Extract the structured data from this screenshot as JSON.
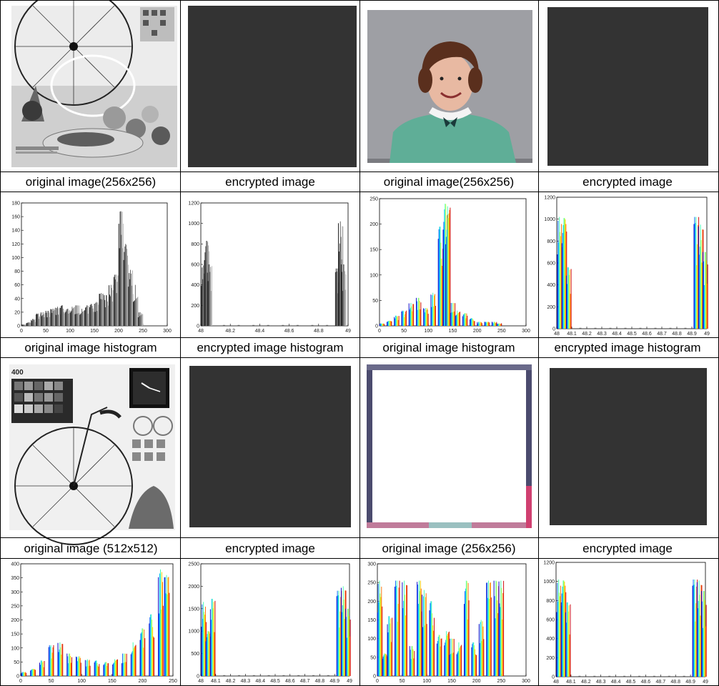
{
  "captions": {
    "row1": [
      "original image(256x256)",
      "encrypted image",
      "original image(256x256)",
      "encrypted image"
    ],
    "row2": [
      "original image histogram",
      "encrypted image histogram",
      "original image histogram",
      "encrypted image histogram"
    ],
    "row3": [
      "original image (512x512)",
      "encrypted image",
      "original image (256x256)",
      "encrypted image"
    ]
  },
  "image_labels": {
    "clock_image_label": "400"
  },
  "colors": {
    "encrypted_fill": "#333333",
    "grid_line": "#000000",
    "portrait_bg": "#9e9fa4",
    "sweater": "#5fae97"
  },
  "chart_data": [
    {
      "type": "bar",
      "panel": "histogram-gray-original",
      "color_scheme": "grayscale",
      "xlim": [
        0,
        300
      ],
      "ylim": [
        0,
        180
      ],
      "xticks": [
        "0",
        "50",
        "100",
        "150",
        "200",
        "250",
        "300"
      ],
      "yticks": [
        "0",
        "20",
        "40",
        "60",
        "80",
        "100",
        "120",
        "140",
        "160",
        "180"
      ],
      "x": [
        5,
        15,
        25,
        35,
        45,
        55,
        65,
        75,
        85,
        95,
        105,
        115,
        125,
        135,
        145,
        155,
        165,
        175,
        185,
        195,
        205,
        215,
        225,
        235,
        245
      ],
      "values": [
        2,
        5,
        10,
        18,
        20,
        22,
        25,
        28,
        30,
        25,
        28,
        30,
        25,
        30,
        32,
        35,
        48,
        45,
        60,
        75,
        168,
        120,
        82,
        60,
        20
      ]
    },
    {
      "type": "bar",
      "panel": "histogram-gray-encrypted",
      "color_scheme": "grayscale",
      "xlim": [
        48,
        49
      ],
      "ylim": [
        0,
        1200
      ],
      "xticks": [
        "48",
        "48.2",
        "48.4",
        "48.6",
        "48.8",
        "49"
      ],
      "yticks": [
        "0",
        "200",
        "400",
        "600",
        "800",
        "1000",
        "1200"
      ],
      "x": [
        48.02,
        48.04,
        48.06,
        48.93,
        48.95,
        48.97
      ],
      "values": [
        590,
        830,
        600,
        560,
        1020,
        600
      ]
    },
    {
      "type": "bar",
      "panel": "histogram-color-original",
      "color_scheme": "rainbow",
      "xlim": [
        0,
        300
      ],
      "ylim": [
        0,
        250
      ],
      "xticks": [
        "0",
        "50",
        "100",
        "150",
        "200",
        "250",
        "300"
      ],
      "yticks": [
        "0",
        "50",
        "100",
        "150",
        "200",
        "250"
      ],
      "x": [
        5,
        20,
        35,
        50,
        65,
        80,
        95,
        110,
        125,
        135,
        140,
        150,
        160,
        175,
        190,
        205,
        220,
        235,
        245
      ],
      "values": [
        5,
        10,
        20,
        30,
        45,
        55,
        35,
        65,
        195,
        240,
        235,
        45,
        30,
        25,
        15,
        8,
        8,
        8,
        5
      ]
    },
    {
      "type": "bar",
      "panel": "histogram-color-encrypted",
      "color_scheme": "rainbow",
      "xlim": [
        48,
        49
      ],
      "ylim": [
        0,
        1200
      ],
      "xticks": [
        "48",
        "48.1",
        "48.2",
        "48.3",
        "48.4",
        "48.5",
        "48.6",
        "48.7",
        "48.8",
        "48.9",
        "49"
      ],
      "yticks": [
        "0",
        "200",
        "400",
        "600",
        "800",
        "1000",
        "1200"
      ],
      "x": [
        48.02,
        48.05,
        48.08,
        48.93,
        48.96,
        48.99
      ],
      "values": [
        1020,
        1010,
        560,
        1020,
        950,
        700
      ]
    },
    {
      "type": "bar",
      "panel": "histogram-clock-original",
      "color_scheme": "rainbow",
      "xlim": [
        0,
        250
      ],
      "ylim": [
        0,
        400
      ],
      "xticks": [
        "0",
        "50",
        "100",
        "150",
        "200",
        "250"
      ],
      "yticks": [
        "0",
        "50",
        "100",
        "150",
        "200",
        "250",
        "300",
        "350",
        "400"
      ],
      "x": [
        5,
        20,
        35,
        50,
        65,
        80,
        95,
        110,
        125,
        140,
        155,
        170,
        185,
        200,
        215,
        230,
        240
      ],
      "values": [
        15,
        25,
        55,
        110,
        120,
        80,
        70,
        60,
        55,
        50,
        60,
        80,
        120,
        170,
        220,
        380,
        360
      ]
    },
    {
      "type": "bar",
      "panel": "histogram-clock-encrypted",
      "color_scheme": "rainbow",
      "xlim": [
        48,
        49
      ],
      "ylim": [
        0,
        2500
      ],
      "xticks": [
        "48",
        "48.1",
        "48.2",
        "48.3",
        "48.4",
        "48.5",
        "48.6",
        "48.7",
        "48.8",
        "48.9",
        "49"
      ],
      "yticks": [
        "0",
        "500",
        "1000",
        "1500",
        "2000",
        "2500"
      ],
      "x": [
        48.02,
        48.05,
        48.08,
        48.93,
        48.96,
        48.99
      ],
      "values": [
        1650,
        1000,
        1720,
        1900,
        2000,
        1500
      ]
    },
    {
      "type": "bar",
      "panel": "histogram-frame-original",
      "color_scheme": "rainbow",
      "xlim": [
        0,
        300
      ],
      "ylim": [
        0,
        300
      ],
      "xticks": [
        "0",
        "50",
        "100",
        "150",
        "200",
        "250",
        "300"
      ],
      "yticks": [
        "0",
        "50",
        "100",
        "150",
        "200",
        "250",
        "300"
      ],
      "x": [
        5,
        15,
        25,
        40,
        55,
        70,
        85,
        95,
        110,
        125,
        140,
        150,
        165,
        180,
        195,
        210,
        225,
        240,
        250
      ],
      "values": [
        255,
        60,
        160,
        255,
        255,
        80,
        255,
        230,
        200,
        110,
        120,
        100,
        90,
        255,
        90,
        150,
        255,
        255,
        255
      ]
    },
    {
      "type": "bar",
      "panel": "histogram-frame-encrypted",
      "color_scheme": "rainbow",
      "xlim": [
        48,
        49
      ],
      "ylim": [
        0,
        1200
      ],
      "xticks": [
        "48",
        "48.1",
        "48.2",
        "48.3",
        "48.4",
        "48.5",
        "48.6",
        "48.7",
        "48.8",
        "48.9",
        "49"
      ],
      "yticks": [
        "0",
        "200",
        "400",
        "600",
        "800",
        "1000",
        "1200"
      ],
      "x": [
        48.02,
        48.05,
        48.08,
        48.93,
        48.96,
        48.99
      ],
      "values": [
        1020,
        1010,
        780,
        1020,
        1010,
        900
      ]
    }
  ]
}
